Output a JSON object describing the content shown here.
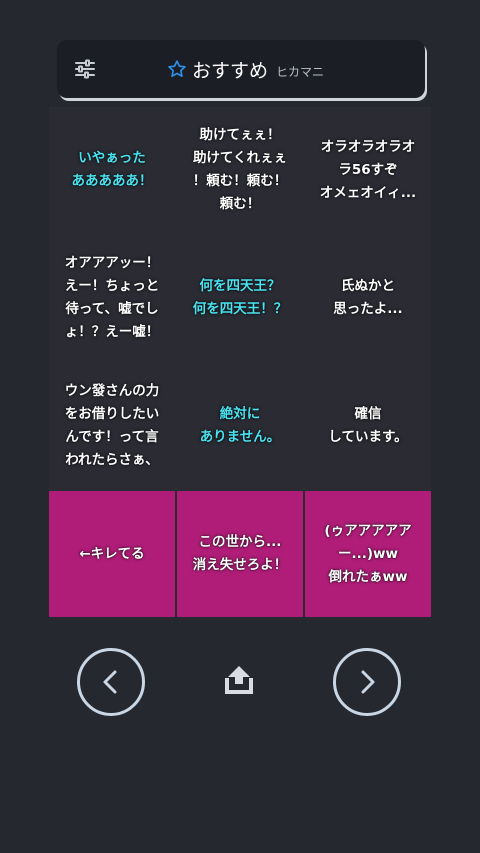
{
  "header": {
    "title": "おすすめ",
    "subtitle": "ヒカマニ",
    "filter_icon": "tune-icon",
    "star_icon": "star-outline-icon"
  },
  "tiles": [
    {
      "text": "いやぁった\nあああああ！",
      "color": "cyan"
    },
    {
      "text": "助けてぇぇ！\n助けてくれぇぇ\n！頼む！頼む！\n頼む！",
      "color": "white"
    },
    {
      "text": "オラオラオラオ\nラ56すぞ\nオメェオイィ...",
      "color": "white"
    },
    {
      "text": "オアアアッー！\nえー！ちょっと\n待って、嘘でし\nょ！？えー嘘！",
      "color": "white"
    },
    {
      "text": "何を四天王？\n何を四天王！？",
      "color": "cyan"
    },
    {
      "text": "氏ぬかと\n思ったよ...",
      "color": "white"
    },
    {
      "text": "ウン發さんの力\nをお借りしたい\nんです！って言\nわれたらさぁ、",
      "color": "white"
    },
    {
      "text": "絶対に\nありません。",
      "color": "cyan"
    },
    {
      "text": "確信\nしています。",
      "color": "white"
    },
    {
      "text": "←キレてる",
      "color": "white"
    },
    {
      "text": "この世から...\n消え失せろよ！",
      "color": "white"
    },
    {
      "text": "(ゥアアアアア\nー...)ww\n倒れたぁww",
      "color": "white"
    }
  ],
  "nav": {
    "prev_icon": "chevron-left-icon",
    "next_icon": "chevron-right-icon",
    "share_icon": "share-upload-icon"
  },
  "colors": {
    "background": "#262830",
    "tile": "#b01d78",
    "highlight_text": "#4be3f0",
    "accent": "#2f8fe8"
  }
}
